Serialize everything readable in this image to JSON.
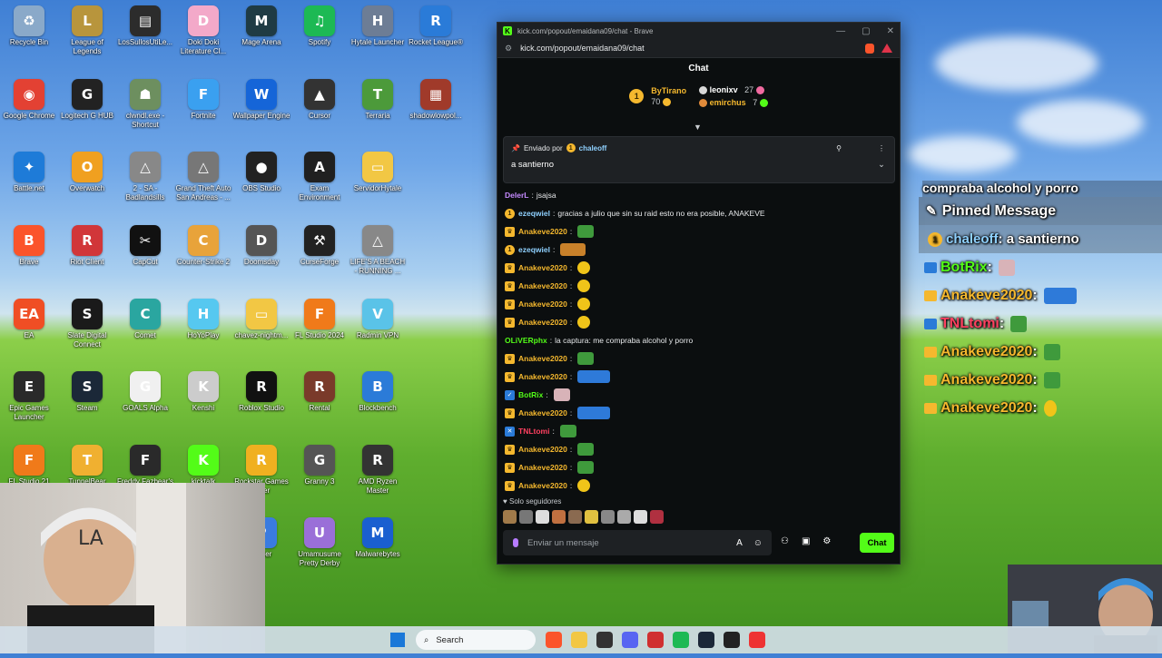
{
  "desktop_icons": [
    {
      "label": "Recycle Bin",
      "color": "#8aa9c9",
      "glyph": "♻"
    },
    {
      "label": "League of Legends",
      "color": "#b8953c",
      "glyph": "L"
    },
    {
      "label": "LosSullosUtiLe...",
      "color": "#2c2c2c",
      "glyph": "▤"
    },
    {
      "label": "Doki Doki Literature Cl...",
      "color": "#f3a9c9",
      "glyph": "D"
    },
    {
      "label": "Mage Arena",
      "color": "#1f3b44",
      "glyph": "M"
    },
    {
      "label": "Spotify",
      "color": "#1db954",
      "glyph": "♫"
    },
    {
      "label": "Hytale Launcher",
      "color": "#6d7d95",
      "glyph": "H"
    },
    {
      "label": "Rocket League®",
      "color": "#2a7bd8",
      "glyph": "R"
    },
    {
      "label": "Google Chrome",
      "color": "#e34133",
      "glyph": "◉"
    },
    {
      "label": "Logitech G HUB",
      "color": "#222222",
      "glyph": "G"
    },
    {
      "label": "clwndl.exe - Shortcut",
      "color": "#6d8f5f",
      "glyph": "☗"
    },
    {
      "label": "Fortnite",
      "color": "#3aa0f0",
      "glyph": "F"
    },
    {
      "label": "Wallpaper Engine",
      "color": "#1565d8",
      "glyph": "W"
    },
    {
      "label": "Cursor",
      "color": "#333333",
      "glyph": "▲"
    },
    {
      "label": "Terraria",
      "color": "#4c9a3a",
      "glyph": "T"
    },
    {
      "label": "shadowlowpol...",
      "color": "#a03a2a",
      "glyph": "▦"
    },
    {
      "label": "Battle.net",
      "color": "#1e7bd8",
      "glyph": "✦"
    },
    {
      "label": "Overwatch",
      "color": "#f0a020",
      "glyph": "O"
    },
    {
      "label": "2 - SA - Badlandsills",
      "color": "#888888",
      "glyph": "△"
    },
    {
      "label": "Grand Theft Auto San Andreas - ...",
      "color": "#777777",
      "glyph": "△"
    },
    {
      "label": "OBS Studio",
      "color": "#222222",
      "glyph": "●"
    },
    {
      "label": "Exam Environment",
      "color": "#202020",
      "glyph": "A"
    },
    {
      "label": "ServidorHytale",
      "color": "#f2c744",
      "glyph": "▭"
    },
    {
      "label": "Brave",
      "color": "#fb542b",
      "glyph": "B"
    },
    {
      "label": "Riot Client",
      "color": "#d13639",
      "glyph": "R"
    },
    {
      "label": "CapCut",
      "color": "#111111",
      "glyph": "✂"
    },
    {
      "label": "Counter-Strike 2",
      "color": "#e8a33a",
      "glyph": "C"
    },
    {
      "label": "Doomsday",
      "color": "#555555",
      "glyph": "D"
    },
    {
      "label": "CurseForge",
      "color": "#222222",
      "glyph": "⚒"
    },
    {
      "label": "LIFE'S A BEACH - RUNNING ...",
      "color": "#888888",
      "glyph": "△"
    },
    {
      "label": "EA",
      "color": "#f04e24",
      "glyph": "EA"
    },
    {
      "label": "Slate Digital Connect",
      "color": "#1a1a1a",
      "glyph": "S"
    },
    {
      "label": "Comet",
      "color": "#2aa6a0",
      "glyph": "C"
    },
    {
      "label": "HoYoPlay",
      "color": "#56c8f0",
      "glyph": "H"
    },
    {
      "label": "chavez-nightm...",
      "color": "#f2c744",
      "glyph": "▭"
    },
    {
      "label": "FL Studio 2024",
      "color": "#f07a1a",
      "glyph": "F"
    },
    {
      "label": "Radmin VPN",
      "color": "#5ac3e8",
      "glyph": "V"
    },
    {
      "label": "Epic Games Launcher",
      "color": "#2a2a2a",
      "glyph": "E"
    },
    {
      "label": "Steam",
      "color": "#1b2838",
      "glyph": "S"
    },
    {
      "label": "GOALS Alpha",
      "color": "#f0f0f0",
      "glyph": "G"
    },
    {
      "label": "Kenshi",
      "color": "#cccccc",
      "glyph": "K"
    },
    {
      "label": "Roblox Studio",
      "color": "#111111",
      "glyph": "R"
    },
    {
      "label": "Rental",
      "color": "#7a3a2a",
      "glyph": "R"
    },
    {
      "label": "Blockbench",
      "color": "#2b7bd8",
      "glyph": "B"
    },
    {
      "label": "FL Studio 21",
      "color": "#f07a1a",
      "glyph": "F"
    },
    {
      "label": "TunnelBear",
      "color": "#f0b030",
      "glyph": "T"
    },
    {
      "label": "Freddy Fazbear's",
      "color": "#2a2a2a",
      "glyph": "F"
    },
    {
      "label": "kicktalk",
      "color": "#53fc18",
      "glyph": "K"
    },
    {
      "label": "Rockstar Games ...her",
      "color": "#f0b020",
      "glyph": "R"
    },
    {
      "label": "Granny 3",
      "color": "#555555",
      "glyph": "G"
    },
    {
      "label": "AMD Ryzen Master",
      "color": "#333333",
      "glyph": "R"
    },
    {
      "label": "Player",
      "color": "#3a7be0",
      "glyph": "P"
    },
    {
      "label": "Umamusume Pretty Derby",
      "color": "#9a6fd8",
      "glyph": "U"
    },
    {
      "label": "Malwarebytes",
      "color": "#1a5fd0",
      "glyph": "M"
    }
  ],
  "browser": {
    "tab_title": "kick.com/popout/emaidana09/chat - Brave",
    "address": "kick.com/popout/emaidana09/chat",
    "controls": [
      "—",
      "▢",
      "✕"
    ]
  },
  "chat": {
    "header": "Chat",
    "gifters": [
      {
        "name": "ByTirano",
        "count": "70",
        "rank": "1"
      },
      {
        "name": "leonixv",
        "count": "27"
      },
      {
        "name": "emirchus",
        "count": "7"
      }
    ],
    "pinned": {
      "by_label": "Enviado por",
      "by_user": "chaleoff",
      "message": "a santierno"
    },
    "messages": [
      {
        "user": "DelerL",
        "color": "#c58aff",
        "text": "jsajsa",
        "badge": "none",
        "emote": ""
      },
      {
        "user": "ezeqwiel",
        "color": "#8fd1ff",
        "text": "gracias a julio que sin su raid esto no era posible, ANAKEVE",
        "badge": "coin",
        "emote": ""
      },
      {
        "user": "Anakeve2020",
        "color": "#f5b82e",
        "text": "",
        "badge": "crown",
        "emote": "pepe"
      },
      {
        "user": "ezeqwiel",
        "color": "#8fd1ff",
        "text": "",
        "badge": "coin",
        "emote": "anim"
      },
      {
        "user": "Anakeve2020",
        "color": "#f5b82e",
        "text": "",
        "badge": "crown",
        "emote": "yel"
      },
      {
        "user": "Anakeve2020",
        "color": "#f5b82e",
        "text": "",
        "badge": "crown",
        "emote": "yel"
      },
      {
        "user": "Anakeve2020",
        "color": "#f5b82e",
        "text": "",
        "badge": "crown",
        "emote": "yel"
      },
      {
        "user": "Anakeve2020",
        "color": "#f5b82e",
        "text": "",
        "badge": "crown",
        "emote": "yel"
      },
      {
        "user": "OLiVERphx",
        "color": "#53fc18",
        "text": "la captura: me compraba alcohol y porro",
        "badge": "none",
        "emote": ""
      },
      {
        "user": "Anakeve2020",
        "color": "#f5b82e",
        "text": "",
        "badge": "crown",
        "emote": "pepe"
      },
      {
        "user": "Anakeve2020",
        "color": "#f5b82e",
        "text": "",
        "badge": "crown",
        "emote": "car"
      },
      {
        "user": "BotRix",
        "color": "#53fc18",
        "text": "",
        "badge": "bot",
        "emote": "face"
      },
      {
        "user": "Anakeve2020",
        "color": "#f5b82e",
        "text": "",
        "badge": "crown",
        "emote": "car"
      },
      {
        "user": "TNLtomi",
        "color": "#ff4060",
        "text": "",
        "badge": "blue",
        "emote": "pepe"
      },
      {
        "user": "Anakeve2020",
        "color": "#f5b82e",
        "text": "",
        "badge": "crown",
        "emote": "pepe"
      },
      {
        "user": "Anakeve2020",
        "color": "#f5b82e",
        "text": "",
        "badge": "crown",
        "emote": "pepe"
      },
      {
        "user": "Anakeve2020",
        "color": "#f5b82e",
        "text": "",
        "badge": "crown",
        "emote": "yel"
      }
    ],
    "followers_only": "Solo seguidores",
    "input_placeholder": "Enviar un mensaje",
    "send_label": "Chat"
  },
  "overlay": {
    "top_text": "compraba alcohol y porro",
    "pinned_title": "Pinned Message",
    "pinned_user": "chaleoff",
    "pinned_text": "a santierno",
    "lines": [
      {
        "user": "BotRix",
        "color": "#53fc18",
        "emote": "face"
      },
      {
        "user": "Anakeve2020",
        "color": "#f5b82e",
        "emote": "car"
      },
      {
        "user": "TNLtomi",
        "color": "#ff4060",
        "emote": "pepe"
      },
      {
        "user": "Anakeve2020",
        "color": "#f5b82e",
        "emote": "pepe"
      },
      {
        "user": "Anakeve2020",
        "color": "#f5b82e",
        "emote": "pepe"
      },
      {
        "user": "Anakeve2020",
        "color": "#f5b82e",
        "emote": "yel"
      }
    ]
  },
  "taskbar": {
    "search_label": "Search"
  }
}
